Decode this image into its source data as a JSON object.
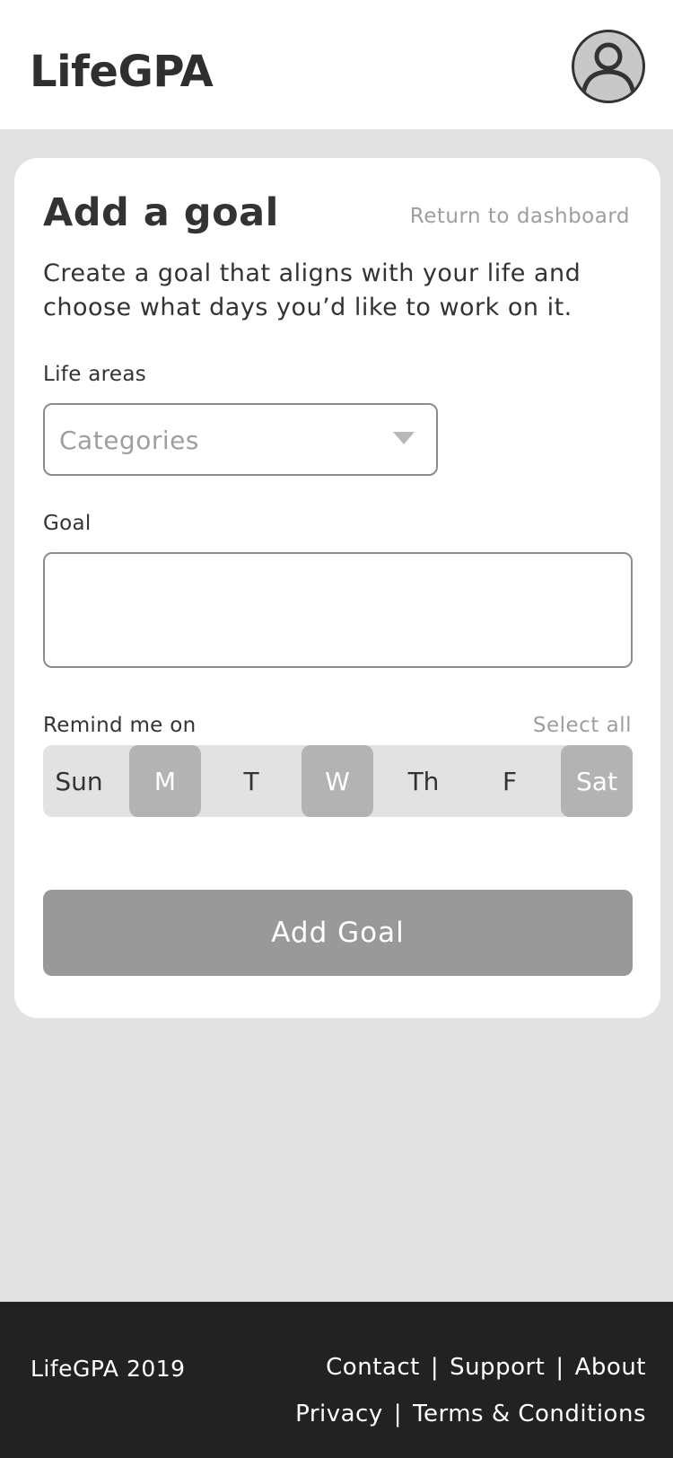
{
  "header": {
    "logo": "LifeGPA",
    "avatar_icon": "user-icon"
  },
  "card": {
    "title": "Add a goal",
    "return_link": "Return to dashboard",
    "description": "Create a goal that aligns with your life and choose what days you’d like to work on it.",
    "life_areas": {
      "label": "Life areas",
      "placeholder": "Categories",
      "caret_icon": "chevron-down-icon"
    },
    "goal": {
      "label": "Goal",
      "value": ""
    },
    "remind": {
      "label": "Remind me on",
      "select_all": "Select all",
      "days": [
        {
          "label": "Sun",
          "selected": false
        },
        {
          "label": "M",
          "selected": true
        },
        {
          "label": "T",
          "selected": false
        },
        {
          "label": "W",
          "selected": true
        },
        {
          "label": "Th",
          "selected": false
        },
        {
          "label": "F",
          "selected": false
        },
        {
          "label": "Sat",
          "selected": true
        }
      ]
    },
    "submit": "Add Goal"
  },
  "footer": {
    "copyright": "LifeGPA 2019",
    "links_row1": [
      "Contact",
      "Support",
      "About"
    ],
    "links_row2": [
      "Privacy",
      "Terms & Conditions"
    ],
    "separator": "|"
  },
  "colors": {
    "background": "#e2e2e2",
    "card": "#ffffff",
    "selected_day": "#b3b3b3",
    "button": "#999999",
    "footer": "#222222"
  }
}
